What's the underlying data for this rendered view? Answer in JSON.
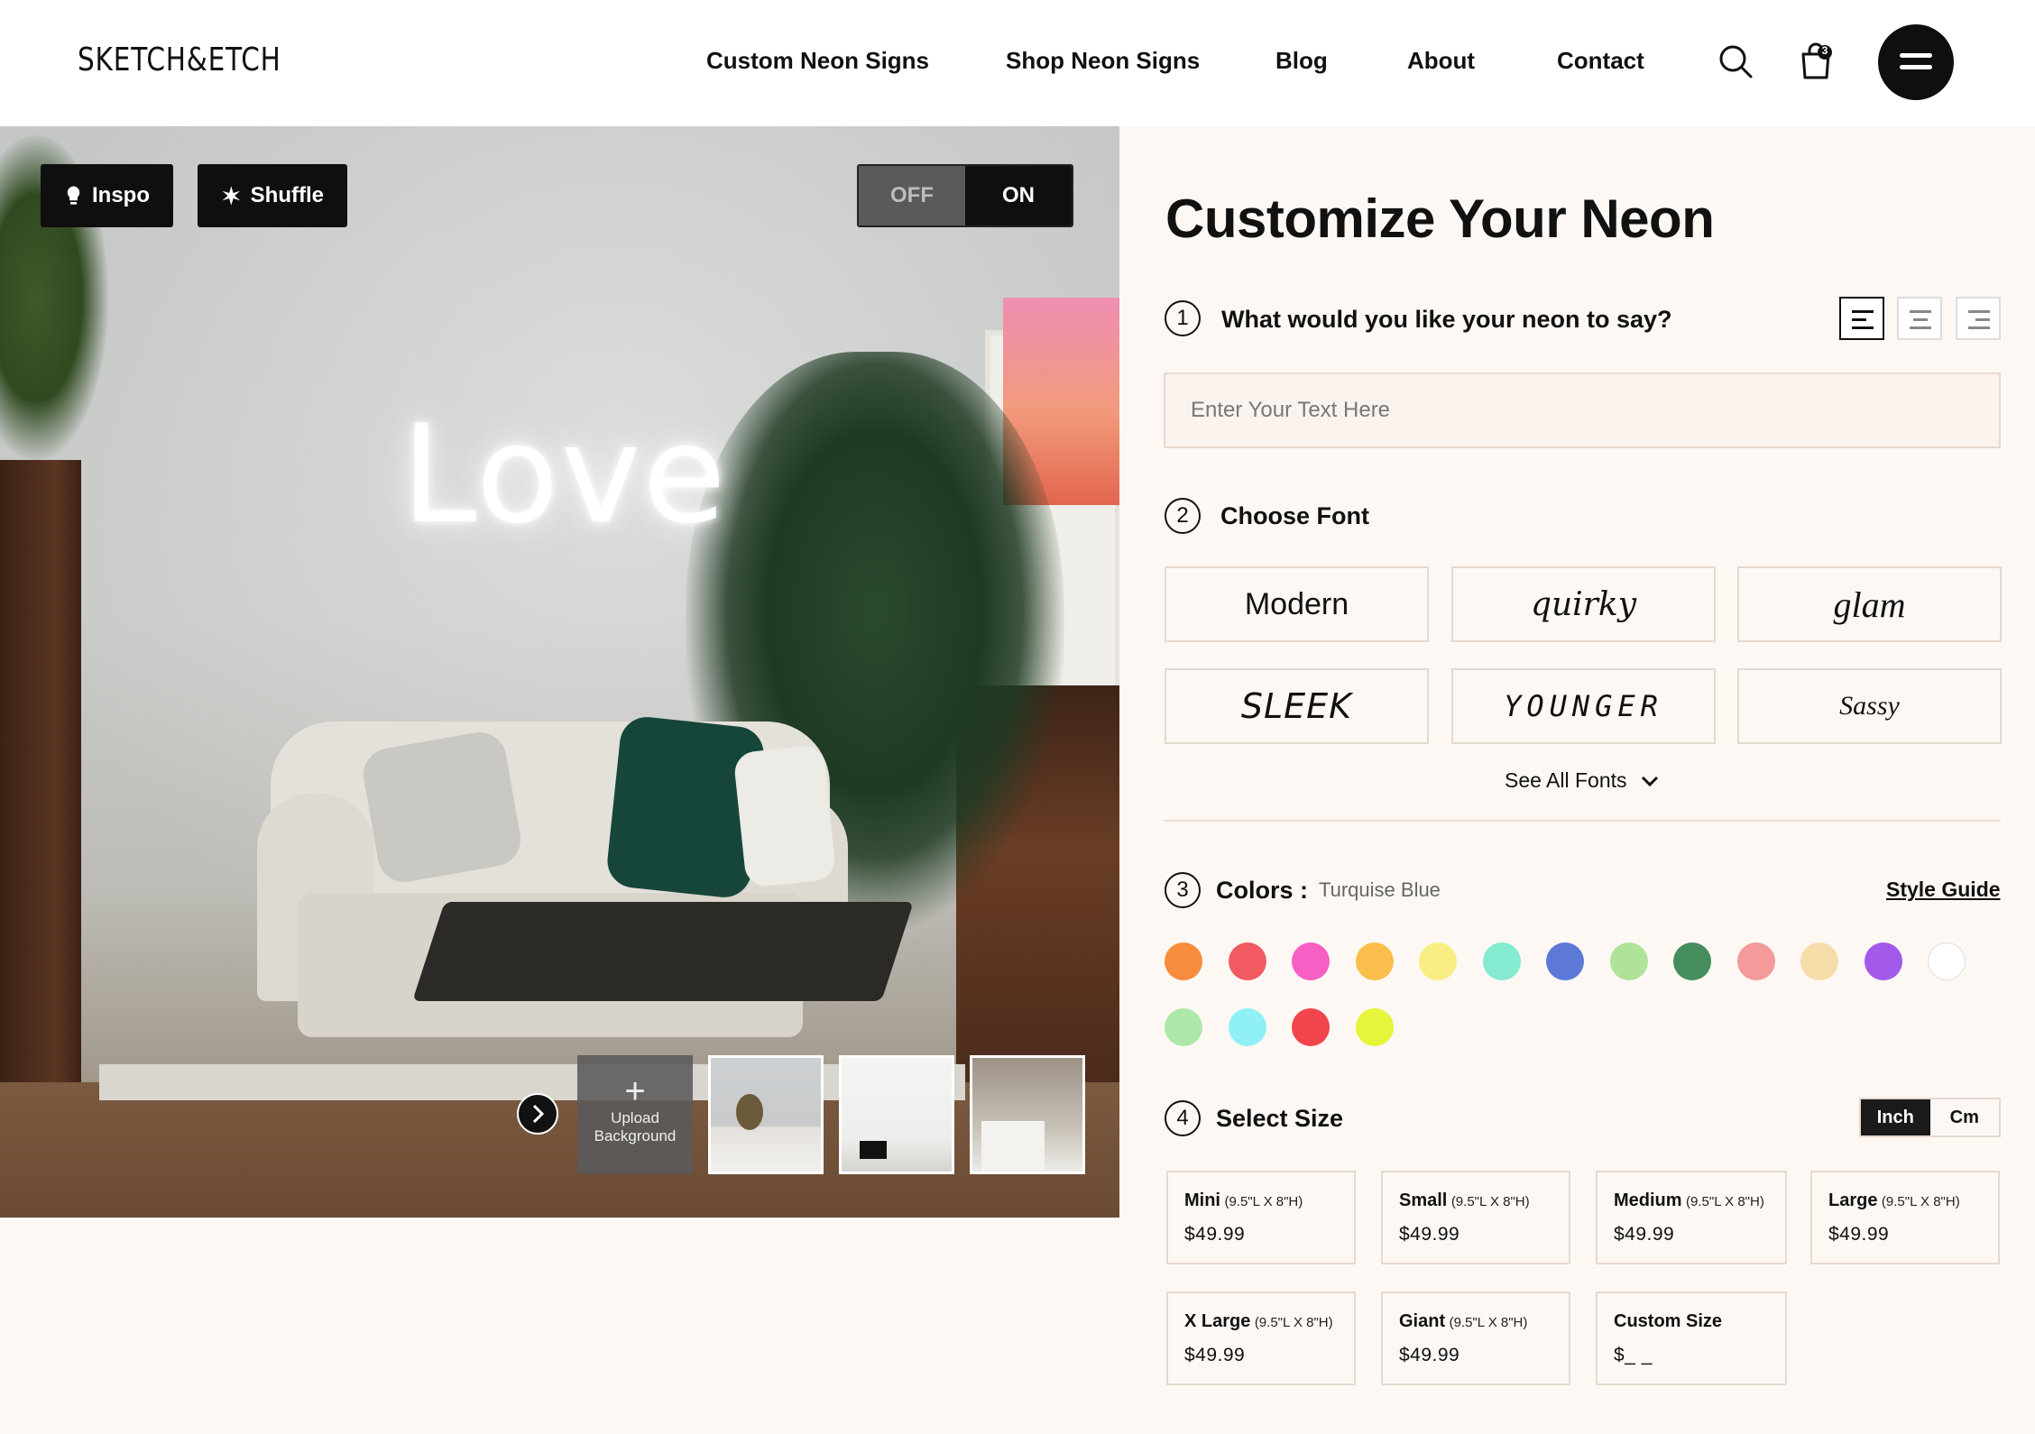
{
  "header": {
    "logo": "SKETCH&ETCH",
    "nav": [
      "Custom Neon Signs",
      "Shop Neon Signs",
      "Blog",
      "About",
      "Contact"
    ],
    "cart_count": "3"
  },
  "preview": {
    "inspo_label": "Inspo",
    "shuffle_label": "Shuffle",
    "toggle_off": "OFF",
    "toggle_on": "ON",
    "toggle_state": "ON",
    "neon_text": "Love",
    "upload_label_1": "Upload",
    "upload_label_2": "Background"
  },
  "panel": {
    "title": "Customize Your Neon",
    "step1": {
      "num": "1",
      "label": "What would you like your neon to say?",
      "placeholder": "Enter Your Text Here",
      "alignment": "left"
    },
    "step2": {
      "num": "2",
      "label": "Choose Font",
      "fonts": [
        "Modern",
        "quirky",
        "glam",
        "SLEEK",
        "YOUNGER",
        "Sassy"
      ],
      "see_all": "See All Fonts"
    },
    "step3": {
      "num": "3",
      "label": "Colors :",
      "selected_color": "Turquise Blue",
      "style_guide": "Style Guide",
      "colors": [
        "#f78c3d",
        "#f05a60",
        "#f660c4",
        "#fbbd4c",
        "#f8ee84",
        "#84ead0",
        "#5c79d8",
        "#b0e39a",
        "#458d5d",
        "#f49a9b",
        "#f6dca8",
        "#a359ea",
        "#ffffff",
        "#aee8a9",
        "#8ff0f6",
        "#f2444c",
        "#e6f53a"
      ]
    },
    "step4": {
      "num": "4",
      "label": "Select Size",
      "unit_inch": "Inch",
      "unit_cm": "Cm",
      "unit_selected": "Inch",
      "sizes": [
        {
          "name": "Mini",
          "dims": "(9.5\"L X 8\"H)",
          "price": "$49.99"
        },
        {
          "name": "Small",
          "dims": "(9.5\"L X 8\"H)",
          "price": "$49.99"
        },
        {
          "name": "Medium",
          "dims": "(9.5\"L X 8\"H)",
          "price": "$49.99"
        },
        {
          "name": "Large",
          "dims": "(9.5\"L X 8\"H)",
          "price": "$49.99"
        },
        {
          "name": "X Large",
          "dims": "(9.5\"L X 8\"H)",
          "price": "$49.99"
        },
        {
          "name": "Giant",
          "dims": "(9.5\"L X 8\"H)",
          "price": "$49.99"
        },
        {
          "name": "Custom Size",
          "dims": "",
          "price": "$_ _"
        }
      ]
    }
  }
}
